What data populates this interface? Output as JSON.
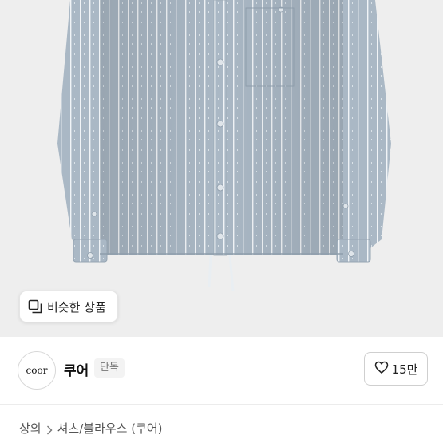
{
  "product": {
    "image_alt": "Blue pinstripe shirt",
    "similar_button_label": "비슷한 상품"
  },
  "store": {
    "avatar_text": "coor",
    "name": "쿠어",
    "badge": "단독",
    "likes_label": "15만"
  },
  "breadcrumb": {
    "items": [
      "상의",
      "셔츠/블라우스 (쿠어)"
    ]
  },
  "colors": {
    "shirt": "#a9b7c4",
    "stripe": "#f3f6f8",
    "background": "#eeeeee"
  },
  "icons": [
    "copy-icon",
    "heart-icon",
    "chevron-right-icon"
  ]
}
